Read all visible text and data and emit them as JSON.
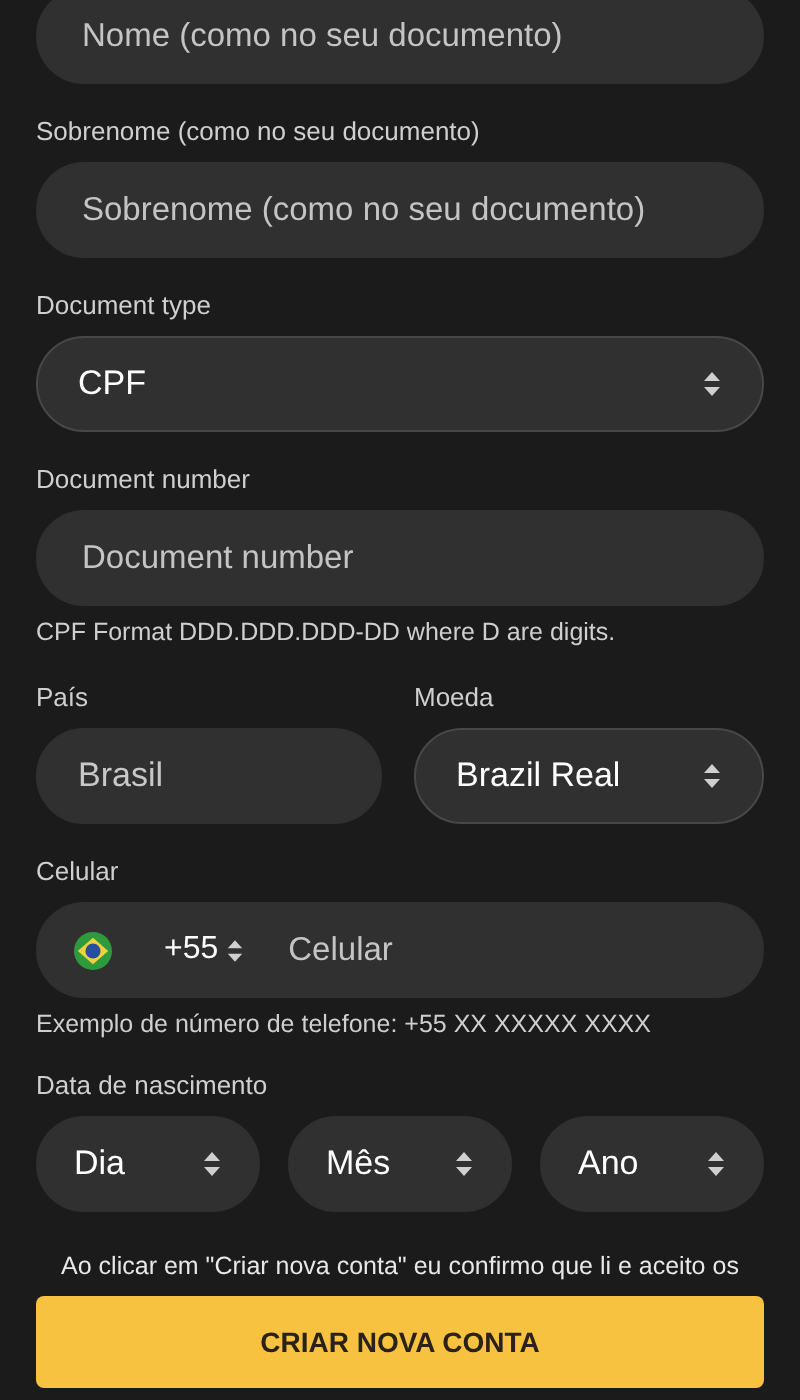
{
  "name": {
    "placeholder": "Nome (como no seu documento)"
  },
  "surname": {
    "label": "Sobrenome (como no seu documento)",
    "placeholder": "Sobrenome (como no seu documento)"
  },
  "document_type": {
    "label": "Document type",
    "value": "CPF"
  },
  "document_number": {
    "label": "Document number",
    "placeholder": "Document number",
    "hint": "CPF Format DDD.DDD.DDD-DD where D are digits."
  },
  "country": {
    "label": "País",
    "value": "Brasil"
  },
  "currency": {
    "label": "Moeda",
    "value": "Brazil Real"
  },
  "phone": {
    "label": "Celular",
    "code": "+55",
    "placeholder": "Celular",
    "hint": "Exemplo de número de telefone: +55 XX XXXXX XXXX"
  },
  "birth_date": {
    "label": "Data de nascimento",
    "selects": [
      {
        "value": "Dia"
      },
      {
        "value": "Mês"
      },
      {
        "value": "Ano"
      }
    ]
  },
  "terms": "Ao clicar em \"Criar nova conta\" eu confirmo que li e aceito os",
  "submit_button": "CRIAR NOVA CONTA"
}
